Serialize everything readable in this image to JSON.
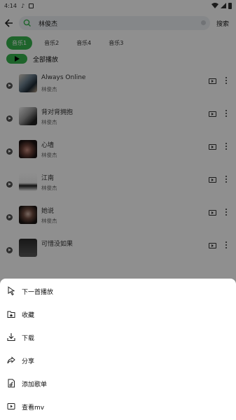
{
  "status_bar": {
    "time": "4:14"
  },
  "search": {
    "query": "林俊杰",
    "button": "搜索"
  },
  "tabs": [
    {
      "label": "音乐1",
      "active": true
    },
    {
      "label": "音乐2",
      "active": false
    },
    {
      "label": "音乐4",
      "active": false
    },
    {
      "label": "音乐3",
      "active": false
    }
  ],
  "play_all": {
    "label": "全部播放"
  },
  "songs": [
    {
      "title": "Always Online",
      "artist": "林俊杰"
    },
    {
      "title": "背对背拥抱",
      "artist": "林俊杰"
    },
    {
      "title": "心墙",
      "artist": "林俊杰"
    },
    {
      "title": "江南",
      "artist": "林俊杰"
    },
    {
      "title": "她说",
      "artist": "林俊杰"
    },
    {
      "title": "可惜没如果",
      "artist": ""
    }
  ],
  "menu": {
    "items": [
      {
        "label": "下一首播放",
        "icon": "play-next-icon"
      },
      {
        "label": "收藏",
        "icon": "favorite-folder-icon"
      },
      {
        "label": "下载",
        "icon": "download-icon"
      },
      {
        "label": "分享",
        "icon": "share-icon"
      },
      {
        "label": "添加歌单",
        "icon": "add-playlist-icon"
      },
      {
        "label": "查看mv",
        "icon": "mv-icon"
      }
    ]
  },
  "colors": {
    "accent": "#37b24d",
    "overlay": "rgba(0,0,0,0.44)"
  }
}
